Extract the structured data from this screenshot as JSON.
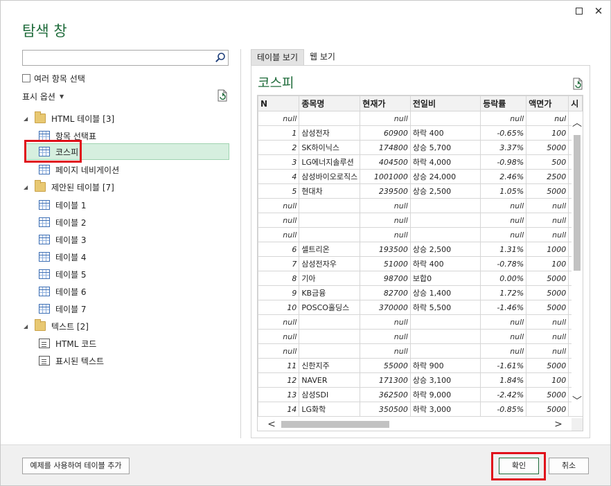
{
  "window": {
    "title": "탐색 창",
    "maximize_label": "",
    "close_label": "✕"
  },
  "left": {
    "search": {
      "value": "",
      "placeholder": ""
    },
    "multi_select_label": "여러 항목 선택",
    "display_options_label": "표시 옵션",
    "tree": [
      {
        "label": "HTML 테이블 [3]",
        "kind": "folder",
        "level": 0
      },
      {
        "label": "항목 선택표",
        "kind": "table",
        "level": 1
      },
      {
        "label": "코스피",
        "kind": "table",
        "level": 1,
        "selected": true
      },
      {
        "label": "페이지 네비게이션",
        "kind": "table",
        "level": 1
      },
      {
        "label": "제안된 테이블 [7]",
        "kind": "folder",
        "level": 0
      },
      {
        "label": "테이블 1",
        "kind": "table",
        "level": 1
      },
      {
        "label": "테이블 2",
        "kind": "table",
        "level": 1
      },
      {
        "label": "테이블 3",
        "kind": "table",
        "level": 1
      },
      {
        "label": "테이블 4",
        "kind": "table",
        "level": 1
      },
      {
        "label": "테이블 5",
        "kind": "table",
        "level": 1
      },
      {
        "label": "테이블 6",
        "kind": "table",
        "level": 1
      },
      {
        "label": "테이블 7",
        "kind": "table",
        "level": 1
      },
      {
        "label": "텍스트 [2]",
        "kind": "folder",
        "level": 0
      },
      {
        "label": "HTML 코드",
        "kind": "doc",
        "level": 1
      },
      {
        "label": "표시된 텍스트",
        "kind": "doc",
        "level": 1
      }
    ]
  },
  "right": {
    "tabs": [
      {
        "label": "테이블 보기",
        "active": true
      },
      {
        "label": "웹 보기",
        "active": false
      }
    ],
    "preview_title": "코스피",
    "columns": [
      "N",
      "종목명",
      "현재가",
      "전일비",
      "등락률",
      "액면가",
      "시"
    ],
    "rows": [
      [
        "null",
        "",
        "null",
        "",
        "null",
        "nul"
      ],
      [
        "1",
        "삼성전자",
        "60900",
        "하락 400",
        "-0.65%",
        "100"
      ],
      [
        "2",
        "SK하이닉스",
        "174800",
        "상승 5,700",
        "3.37%",
        "5000"
      ],
      [
        "3",
        "LG에너지솔루션",
        "404500",
        "하락 4,000",
        "-0.98%",
        "500"
      ],
      [
        "4",
        "삼성바이오로직스",
        "1001000",
        "상승 24,000",
        "2.46%",
        "2500"
      ],
      [
        "5",
        "현대차",
        "239500",
        "상승 2,500",
        "1.05%",
        "5000"
      ],
      [
        "null",
        "",
        "null",
        "",
        "null",
        "null"
      ],
      [
        "null",
        "",
        "null",
        "",
        "null",
        "null"
      ],
      [
        "null",
        "",
        "null",
        "",
        "null",
        "null"
      ],
      [
        "6",
        "셀트리온",
        "193500",
        "상승 2,500",
        "1.31%",
        "1000"
      ],
      [
        "7",
        "삼성전자우",
        "51000",
        "하락 400",
        "-0.78%",
        "100"
      ],
      [
        "8",
        "기아",
        "98700",
        "보합0",
        "0.00%",
        "5000"
      ],
      [
        "9",
        "KB금융",
        "82700",
        "상승 1,400",
        "1.72%",
        "5000"
      ],
      [
        "10",
        "POSCO홀딩스",
        "370000",
        "하락 5,500",
        "-1.46%",
        "5000"
      ],
      [
        "null",
        "",
        "null",
        "",
        "null",
        "null"
      ],
      [
        "null",
        "",
        "null",
        "",
        "null",
        "null"
      ],
      [
        "null",
        "",
        "null",
        "",
        "null",
        "null"
      ],
      [
        "11",
        "신한지주",
        "55000",
        "하락 900",
        "-1.61%",
        "5000"
      ],
      [
        "12",
        "NAVER",
        "171300",
        "상승 3,100",
        "1.84%",
        "100"
      ],
      [
        "13",
        "삼성SDI",
        "362500",
        "하락 9,000",
        "-2.42%",
        "5000"
      ],
      [
        "14",
        "LG화학",
        "350500",
        "하락 3,000",
        "-0.85%",
        "5000"
      ]
    ]
  },
  "footer": {
    "example_button": "예제를 사용하여 테이블 추가",
    "ok_button": "확인",
    "cancel_button": "취소"
  },
  "colors": {
    "accent": "#1e6b3a",
    "selection_bg": "#d6efdf",
    "highlight_box": "#e0101a"
  }
}
